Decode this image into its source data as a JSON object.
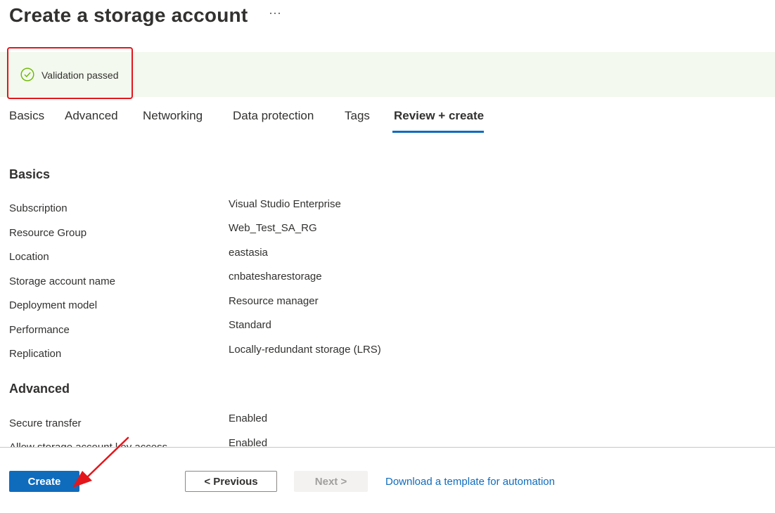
{
  "header": {
    "title": "Create a storage account",
    "more_label": "···"
  },
  "banner": {
    "text": "Validation passed",
    "status_color": "#6bb700"
  },
  "tabs": [
    {
      "label": "Basics"
    },
    {
      "label": "Advanced"
    },
    {
      "label": "Networking"
    },
    {
      "label": "Data protection"
    },
    {
      "label": "Tags"
    },
    {
      "label": "Review + create",
      "active": true
    }
  ],
  "basics": {
    "heading": "Basics",
    "rows": [
      {
        "label": "Subscription",
        "value": "Visual Studio Enterprise"
      },
      {
        "label": "Resource Group",
        "value": "Web_Test_SA_RG"
      },
      {
        "label": "Location",
        "value": "eastasia"
      },
      {
        "label": "Storage account name",
        "value": "cnbatesharestorage"
      },
      {
        "label": "Deployment model",
        "value": "Resource manager"
      },
      {
        "label": "Performance",
        "value": "Standard"
      },
      {
        "label": "Replication",
        "value": "Locally-redundant storage (LRS)"
      }
    ]
  },
  "advanced": {
    "heading": "Advanced",
    "rows": [
      {
        "label": "Secure transfer",
        "value": "Enabled"
      },
      {
        "label": "Allow storage account key access",
        "value": "Enabled"
      }
    ]
  },
  "footer": {
    "create_label": "Create",
    "previous_label": "< Previous",
    "next_label": "Next >",
    "download_link": "Download a template for automation"
  },
  "colors": {
    "accent": "#0f6cbd",
    "highlight": "#e3161b",
    "banner_bg": "#f3f9ee"
  }
}
